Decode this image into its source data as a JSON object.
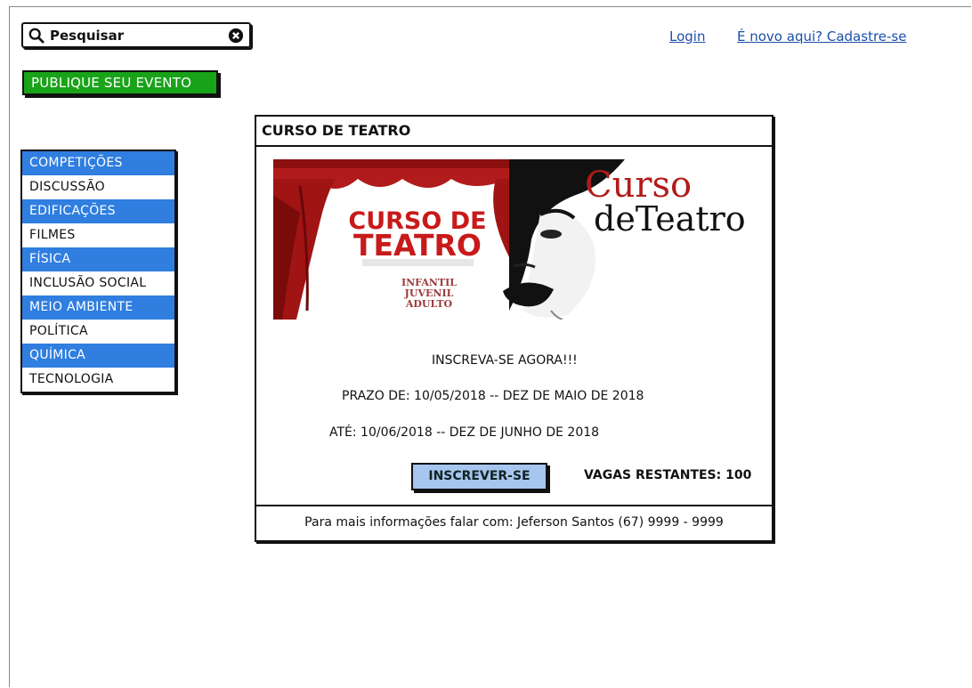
{
  "search": {
    "placeholder": "Pesquisar"
  },
  "header": {
    "login_label": "Login",
    "register_label": "É novo aqui? Cadastre-se"
  },
  "publish_label": "PUBLIQUE SEU EVENTO",
  "categories": [
    {
      "label": "COMPETIÇÕES",
      "highlight": true
    },
    {
      "label": "DISCUSSÃO",
      "highlight": false
    },
    {
      "label": "EDIFICAÇÕES",
      "highlight": true
    },
    {
      "label": "FILMES",
      "highlight": false
    },
    {
      "label": "FÍSICA",
      "highlight": true
    },
    {
      "label": "INCLUSÃO SOCIAL",
      "highlight": false
    },
    {
      "label": "MEIO AMBIENTE",
      "highlight": true
    },
    {
      "label": "POLÍTICA",
      "highlight": false
    },
    {
      "label": "QUÍMICA",
      "highlight": true
    },
    {
      "label": "TECNOLOGIA",
      "highlight": false
    }
  ],
  "event": {
    "title": "CURSO DE TEATRO",
    "banner": {
      "left_title_line1": "CURSO DE",
      "left_title_line2": "TEATRO",
      "audience": [
        "INFANTIL",
        "JUVENIL",
        "ADULTO"
      ],
      "right_title_line1": "Curso",
      "right_title_line2": "deTeatro"
    },
    "cta_text": "INSCREVA-SE AGORA!!!",
    "deadline_from": "PRAZO DE: 10/05/2018 -- DEZ DE MAIO DE 2018",
    "deadline_to": "ATÉ: 10/06/2018 -- DEZ DE JUNHO DE 2018",
    "subscribe_label": "INSCREVER-SE",
    "spots_text": "VAGAS RESTANTES: 100",
    "contact_text": "Para mais informações falar com: Jeferson Santos (67) 9999 - 9999"
  },
  "colors": {
    "publish_green": "#19a319",
    "category_blue": "#2f7ee0",
    "button_blue": "#a6c6ef",
    "link_blue": "#1c4fa8",
    "curtain_red": "#b21b1b"
  }
}
